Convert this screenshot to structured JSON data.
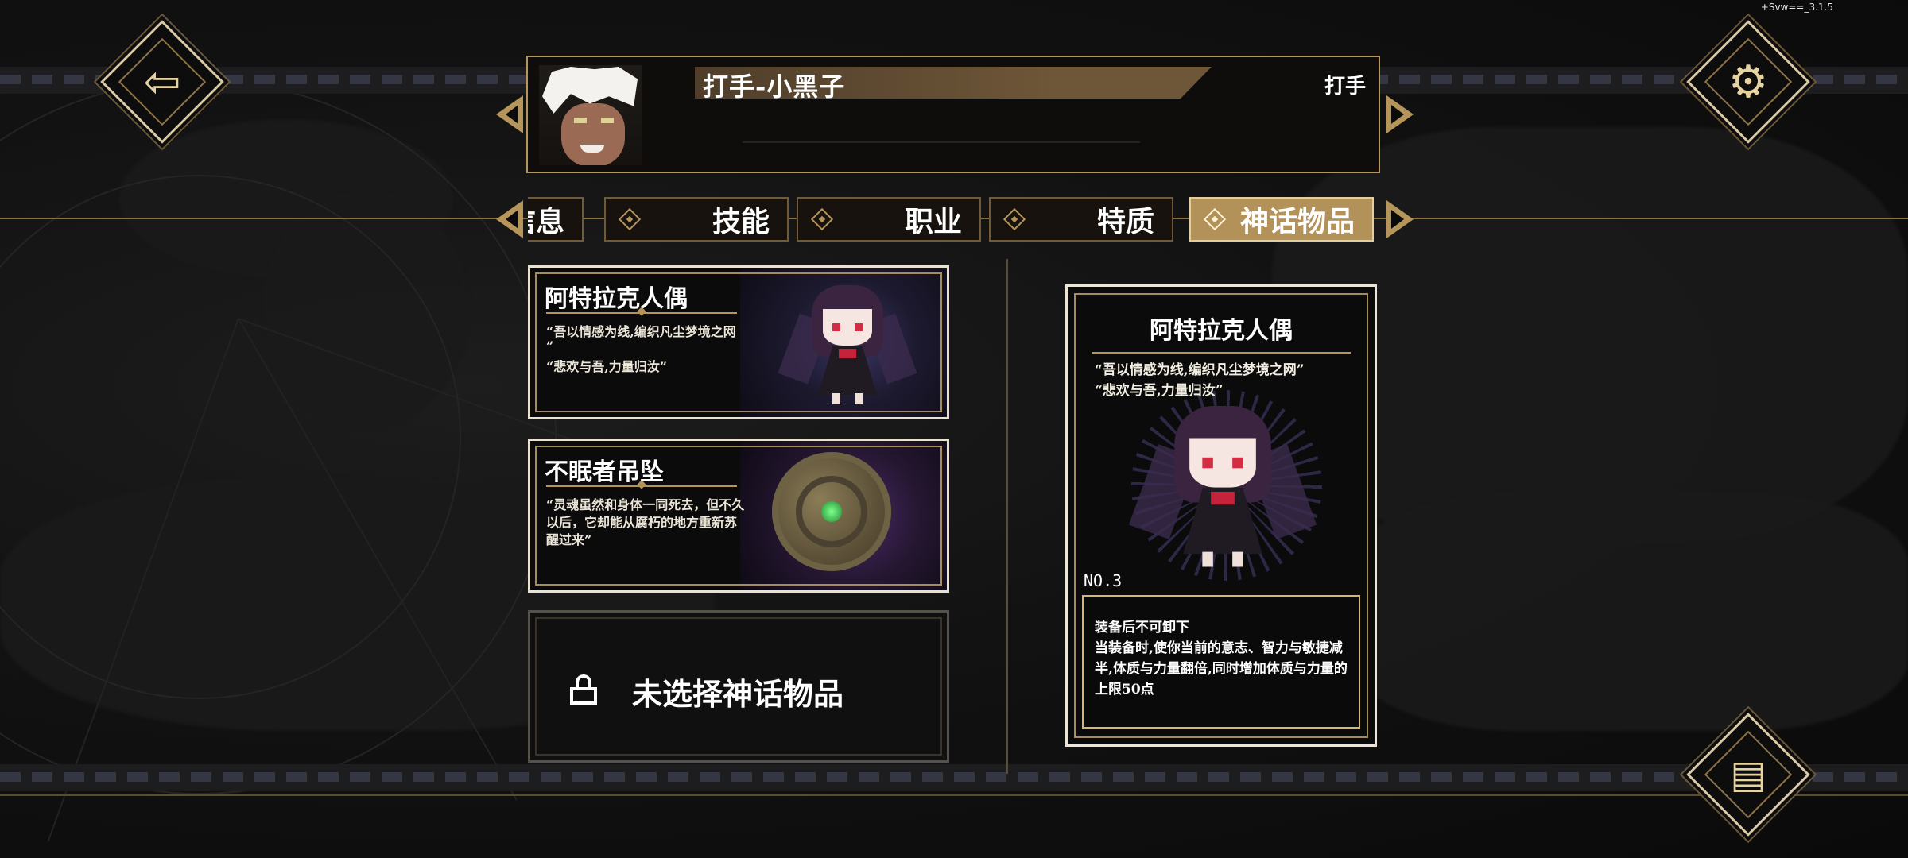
{
  "version": "+Svw==_3.1.5",
  "header": {
    "name": "打手-小黑子",
    "class": "打手"
  },
  "tabs": [
    {
      "label": "信息",
      "active": false
    },
    {
      "label": "技能",
      "active": false
    },
    {
      "label": "职业",
      "active": false
    },
    {
      "label": "特质",
      "active": false
    },
    {
      "label": "神话物品",
      "active": true
    }
  ],
  "items": [
    {
      "title": "阿特拉克人偶",
      "lines": [
        "“吾以情感为线,编织凡尘梦境之网",
        "”",
        "“悲欢与吾,力量归汝”"
      ]
    },
    {
      "title": "不眠者吊坠",
      "lines": [
        "“灵魂虽然和身体一同死去，但不久以后，它却能从腐朽的地方重新苏醒过来”"
      ]
    }
  ],
  "empty_slot": {
    "label": "未选择神话物品"
  },
  "detail": {
    "title": "阿特拉克人偶",
    "quote_1": "“吾以情感为线,编织凡尘梦境之网”",
    "quote_2": "“悲欢与吾,力量归汝”",
    "number": "NO.3",
    "effect_1": "装备后不可卸下",
    "effect_2": "当装备时,使你当前的意志、智力与敏捷减半,体质与力量翻倍,同时增加体质与力量的上限50点"
  },
  "colors": {
    "gold": "#b6955a",
    "active_tab": "#b3925a",
    "background": "#0b0b0b"
  },
  "icons": {
    "back": "back-arrow-icon",
    "settings": "gear-icon",
    "cards": "cards-icon",
    "lock": "lock-icon"
  }
}
